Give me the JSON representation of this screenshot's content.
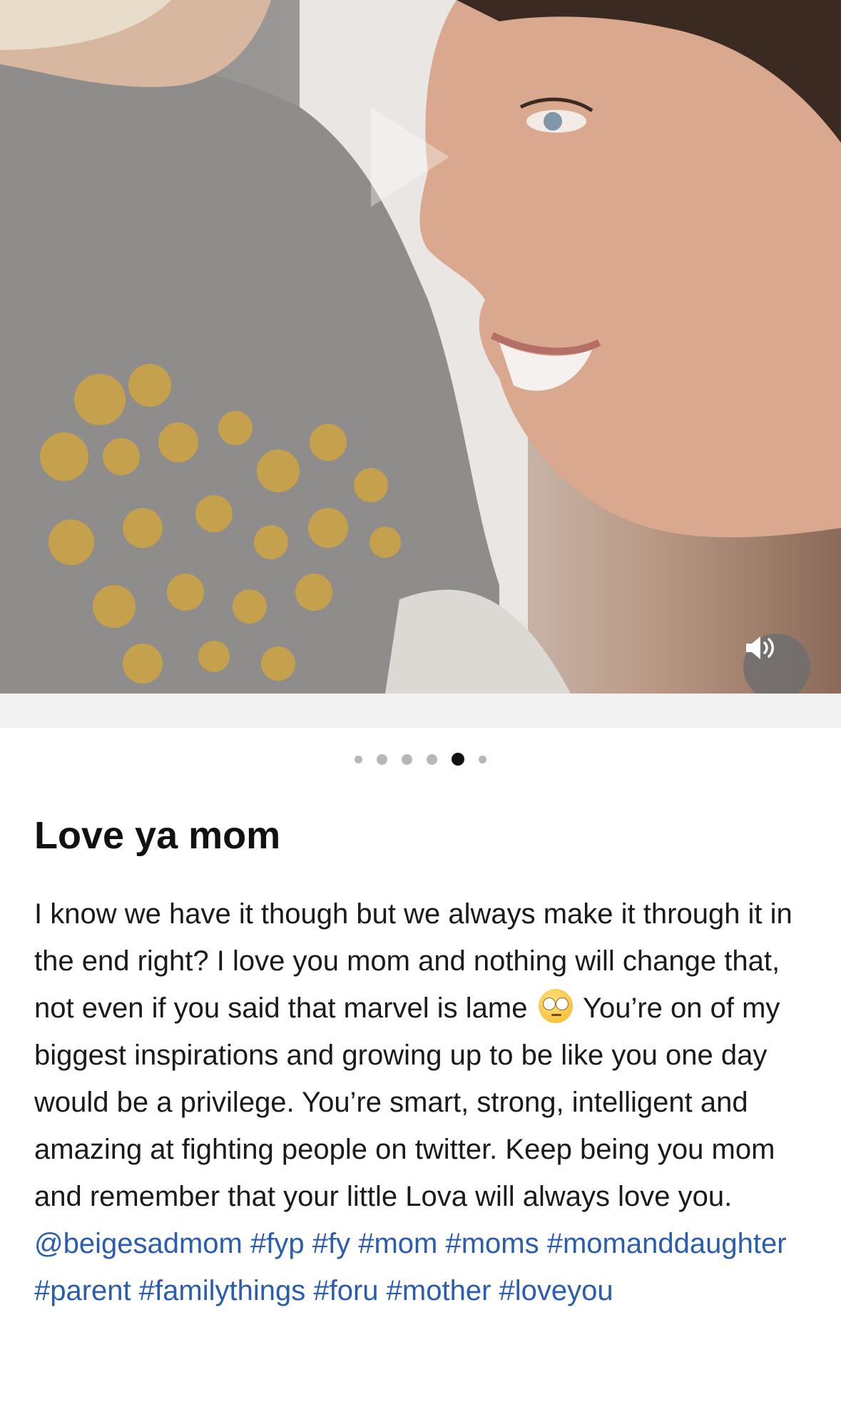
{
  "media": {
    "slide_count": 6,
    "active_slide": 5,
    "sound_icon": "speaker-on-icon",
    "colors": {
      "shirt": "#8f8d8c",
      "hearts": "#c8a24a",
      "skin": "#d9a88e"
    }
  },
  "post": {
    "title": "Love ya mom",
    "text_1": "I know we have it though but we always make it through it in the end right? I love you mom and nothing will change that, not even if you said that marvel is lame ",
    "emoji_icon": "eye-roll-emoji-icon",
    "text_2": " You’re on of my biggest inspirations and growing up to be like you one day would be a privilege. You’re smart, strong, intelligent and amazing at fighting people on twitter. Keep being you mom and remember that your little Lova will always love you. ",
    "mention": "@beigesadmom",
    "hashtags": [
      "#fyp",
      "#fy",
      "#mom",
      "#moms",
      "#momanddaughter",
      "#parent",
      "#familythings",
      "#foru",
      "#mother",
      "#loveyou"
    ]
  }
}
